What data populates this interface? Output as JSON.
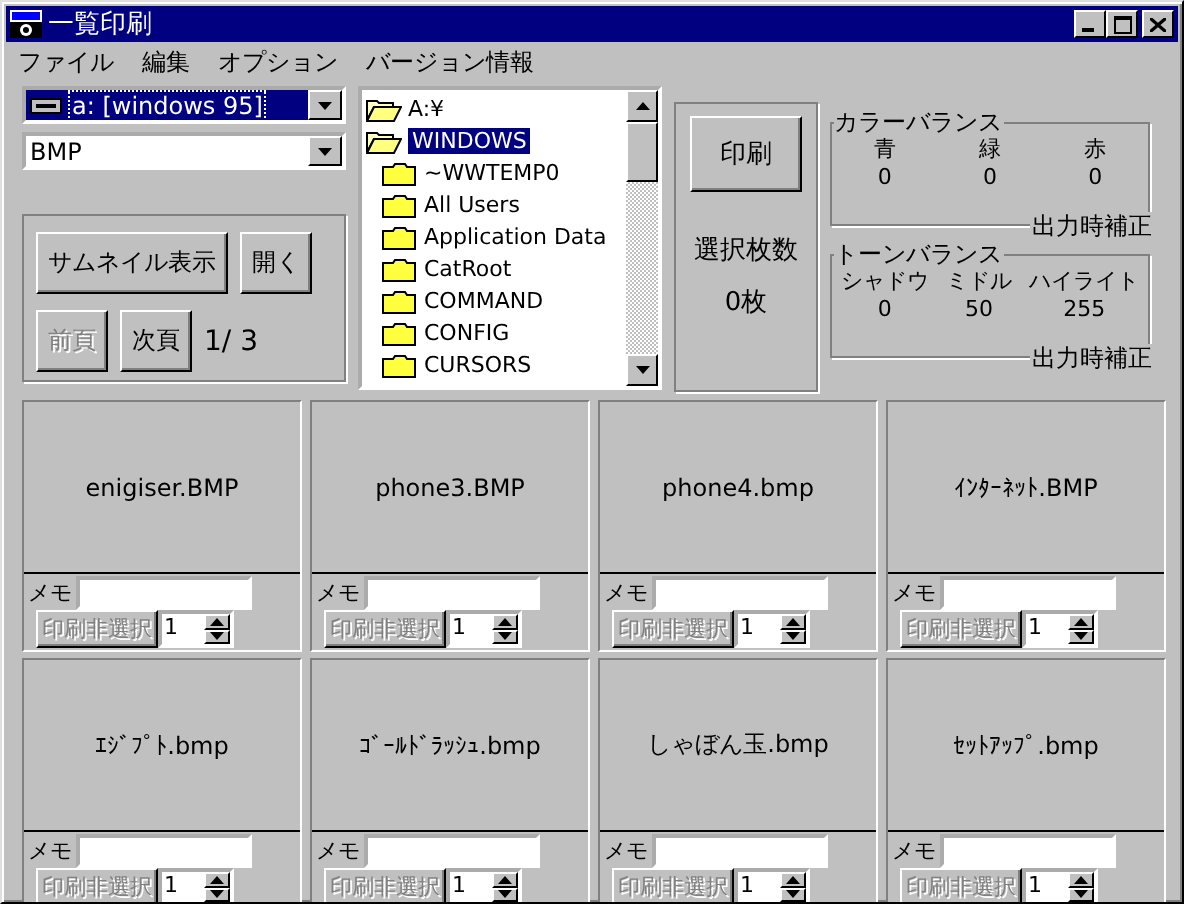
{
  "window": {
    "title": "一覧印刷"
  },
  "menu": [
    "ファイル",
    "編集",
    "オプション",
    "バージョン情報"
  ],
  "drive_combo": {
    "value": "a: [windows 95]"
  },
  "format_combo": {
    "value": "BMP"
  },
  "view_buttons": [
    {
      "label": "サムネイル表示",
      "disabled": false
    },
    {
      "label": "開く",
      "disabled": false
    }
  ],
  "page_buttons": [
    {
      "label": "前頁",
      "disabled": true
    },
    {
      "label": "次頁",
      "disabled": false
    }
  ],
  "page_indicator": "1/ 3",
  "folder_tree": [
    {
      "label": "A:¥",
      "selected": false,
      "expanded": true,
      "children": [
        {
          "label": "WINDOWS",
          "selected": true,
          "expanded": true,
          "children": [
            {
              "label": "~WWTEMP0",
              "selected": false,
              "expanded": false
            },
            {
              "label": "All Users",
              "selected": false,
              "expanded": false
            },
            {
              "label": "Application Data",
              "selected": false,
              "expanded": false
            },
            {
              "label": "CatRoot",
              "selected": false,
              "expanded": false
            },
            {
              "label": "COMMAND",
              "selected": false,
              "expanded": false
            },
            {
              "label": "CONFIG",
              "selected": false,
              "expanded": false
            },
            {
              "label": "CURSORS",
              "selected": false,
              "expanded": false
            }
          ]
        }
      ]
    }
  ],
  "print_panel": {
    "print_button": "印刷",
    "selected_count_label": "選択枚数",
    "selected_count": "0枚"
  },
  "color_balance": {
    "title": "カラーバランス",
    "columns": [
      {
        "label": "青",
        "value": "0"
      },
      {
        "label": "緑",
        "value": "0"
      },
      {
        "label": "赤",
        "value": "0"
      }
    ],
    "footer": "出力時補正"
  },
  "tone_balance": {
    "title": "トーンバランス",
    "columns": [
      {
        "label": "シャドウ",
        "value": "0"
      },
      {
        "label": "ミドル",
        "value": "50"
      },
      {
        "label": "ハイライト",
        "value": "255"
      }
    ],
    "footer": "出力時補正"
  },
  "cards": [
    {
      "filename": "enigiser.BMP",
      "memo_label": "メモ",
      "button": {
        "label": "印刷非選択",
        "disabled": true
      },
      "copies": "1"
    },
    {
      "filename": "phone3.BMP",
      "memo_label": "メモ",
      "button": {
        "label": "印刷非選択",
        "disabled": true
      },
      "copies": "1"
    },
    {
      "filename": "phone4.bmp",
      "memo_label": "メモ",
      "button": {
        "label": "印刷非選択",
        "disabled": true
      },
      "copies": "1"
    },
    {
      "filename": "ｲﾝﾀｰﾈｯﾄ.BMP",
      "memo_label": "メモ",
      "button": {
        "label": "印刷非選択",
        "disabled": true
      },
      "copies": "1"
    },
    {
      "filename": "ｴｼﾞﾌﾟﾄ.bmp",
      "memo_label": "メモ",
      "button": {
        "label": "印刷非選択",
        "disabled": true
      },
      "copies": "1"
    },
    {
      "filename": "ｺﾞｰﾙﾄﾞﾗｯｼｭ.bmp",
      "memo_label": "メモ",
      "button": {
        "label": "印刷非選択",
        "disabled": true
      },
      "copies": "1"
    },
    {
      "filename": "しゃぼん玉.bmp",
      "memo_label": "メモ",
      "button": {
        "label": "印刷非選択",
        "disabled": true
      },
      "copies": "1"
    },
    {
      "filename": "ｾｯﾄｱｯﾌﾟ.bmp",
      "memo_label": "メモ",
      "button": {
        "label": "印刷非選択",
        "disabled": true
      },
      "copies": "1"
    }
  ]
}
